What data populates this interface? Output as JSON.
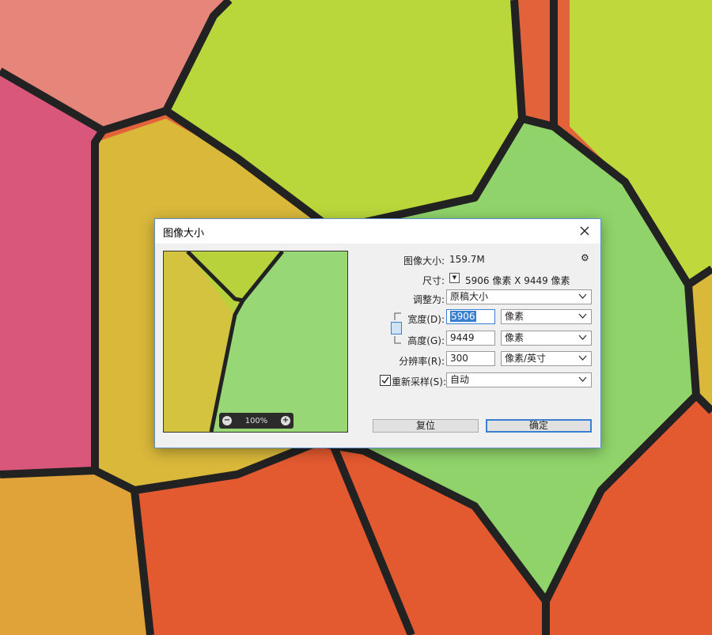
{
  "dialog": {
    "title": "图像大小",
    "close_icon": "close-icon"
  },
  "preview": {
    "zoom_label": "100%",
    "zoom_out_icon": "minus-icon",
    "zoom_in_icon": "plus-icon"
  },
  "info": {
    "size_label": "图像大小:",
    "size_value": "159.7M",
    "gear_icon": "gear-icon",
    "dims_label": "尺寸:",
    "dims_value": "5906 像素  X  9449 像素"
  },
  "fit": {
    "label": "调整为:",
    "value": "原稿大小"
  },
  "width": {
    "label": "宽度(D):",
    "value": "5906",
    "unit": "像素"
  },
  "height": {
    "label": "高度(G):",
    "value": "9449",
    "unit": "像素"
  },
  "resolution": {
    "label": "分辨率(R):",
    "value": "300",
    "unit": "像素/英寸"
  },
  "resample": {
    "label": "重新采样(S):",
    "value": "自动",
    "checked": true
  },
  "buttons": {
    "reset": "复位",
    "ok": "确定"
  },
  "colors": {
    "accent": "#3a7fd0",
    "dialog_bg": "#f0f0f0"
  }
}
